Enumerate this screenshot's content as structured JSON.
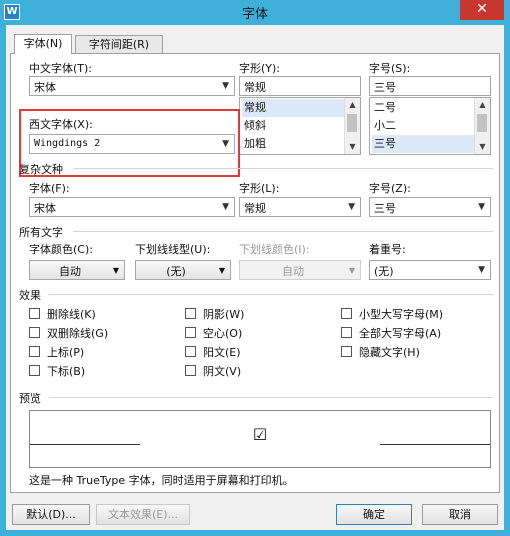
{
  "window": {
    "title": "字体",
    "app_icon": "W",
    "close_glyph": "✕"
  },
  "tabs": [
    {
      "label": "字体(N)"
    },
    {
      "label": "字符间距(R)"
    }
  ],
  "cn_font": {
    "label": "中文字体(T):",
    "value": "宋体"
  },
  "style": {
    "label": "字形(Y):",
    "value": "常规",
    "options": [
      "常规",
      "倾斜",
      "加粗"
    ],
    "selected": "常规"
  },
  "size": {
    "label": "字号(S):",
    "value": "三号",
    "options": [
      "二号",
      "小二",
      "三号"
    ],
    "selected": "三号"
  },
  "west_font": {
    "label": "西文字体(X):",
    "value": "Wingdings 2"
  },
  "complex": {
    "section": "复杂文种",
    "font_label": "字体(F):",
    "font_value": "宋体",
    "style_label": "字形(L):",
    "style_value": "常规",
    "size_label": "字号(Z):",
    "size_value": "三号"
  },
  "all_text": {
    "section": "所有文字",
    "color_label": "字体颜色(C):",
    "color_value": "自动",
    "underline_label": "下划线线型(U):",
    "underline_value": "(无)",
    "underline_color_label": "下划线颜色(I):",
    "underline_color_value": "自动",
    "emphasis_label": "着重号:",
    "emphasis_value": "(无)"
  },
  "effects": {
    "section": "效果",
    "items": [
      "删除线(K)",
      "双删除线(G)",
      "上标(P)",
      "下标(B)",
      "阴影(W)",
      "空心(O)",
      "阳文(E)",
      "阴文(V)",
      "小型大写字母(M)",
      "全部大写字母(A)",
      "隐藏文字(H)"
    ]
  },
  "preview": {
    "section": "预览",
    "sample": "☑",
    "note": "这是一种 TrueType 字体，同时适用于屏幕和打印机。"
  },
  "buttons": {
    "default": "默认(D)...",
    "text_effects": "文本效果(E)...",
    "ok": "确定",
    "cancel": "取消"
  },
  "icons": {
    "dropdown": "▼",
    "scroll_up": "▲",
    "scroll_down": "▼"
  }
}
